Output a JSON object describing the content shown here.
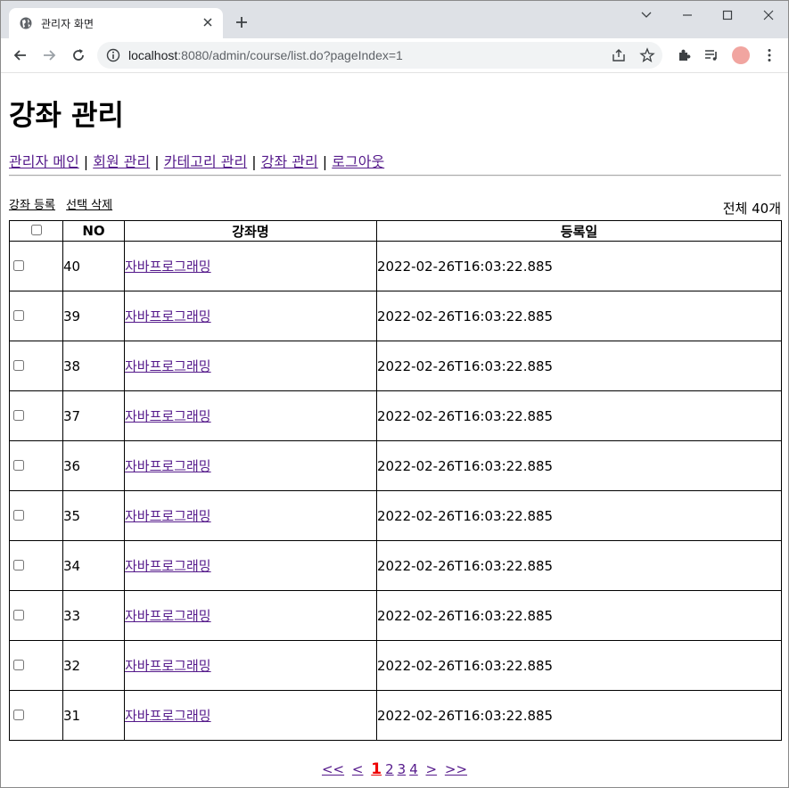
{
  "browser": {
    "tab_title": "관리자 화면",
    "url_host": "localhost",
    "url_rest": ":8080/admin/course/list.do?pageIndex=1"
  },
  "page": {
    "heading": "강좌 관리",
    "nav": [
      {
        "label": "관리자 메인"
      },
      {
        "label": "회원 관리"
      },
      {
        "label": "카테고리 관리"
      },
      {
        "label": "강좌 관리"
      },
      {
        "label": "로그아웃"
      }
    ],
    "nav_separator": " | ",
    "actions": {
      "add_label": "강좌 등록",
      "delete_label": "선택 삭제"
    },
    "total_label": "전체 40개",
    "table": {
      "headers": {
        "no": "NO",
        "name": "강좌명",
        "date": "등록일"
      },
      "rows": [
        {
          "no": "40",
          "name": "자바프로그래밍",
          "date": "2022-02-26T16:03:22.885"
        },
        {
          "no": "39",
          "name": "자바프로그래밍",
          "date": "2022-02-26T16:03:22.885"
        },
        {
          "no": "38",
          "name": "자바프로그래밍",
          "date": "2022-02-26T16:03:22.885"
        },
        {
          "no": "37",
          "name": "자바프로그래밍",
          "date": "2022-02-26T16:03:22.885"
        },
        {
          "no": "36",
          "name": "자바프로그래밍",
          "date": "2022-02-26T16:03:22.885"
        },
        {
          "no": "35",
          "name": "자바프로그래밍",
          "date": "2022-02-26T16:03:22.885"
        },
        {
          "no": "34",
          "name": "자바프로그래밍",
          "date": "2022-02-26T16:03:22.885"
        },
        {
          "no": "33",
          "name": "자바프로그래밍",
          "date": "2022-02-26T16:03:22.885"
        },
        {
          "no": "32",
          "name": "자바프로그래밍",
          "date": "2022-02-26T16:03:22.885"
        },
        {
          "no": "31",
          "name": "자바프로그래밍",
          "date": "2022-02-26T16:03:22.885"
        }
      ]
    },
    "pager": {
      "first": "<<",
      "prev": "<",
      "pages": [
        "1",
        "2",
        "3",
        "4"
      ],
      "current": "1",
      "next": ">",
      "last": ">>"
    }
  },
  "colors": {
    "link": "#551a8b",
    "current_page": "#ee0000",
    "tabstrip": "#dee1e6"
  }
}
